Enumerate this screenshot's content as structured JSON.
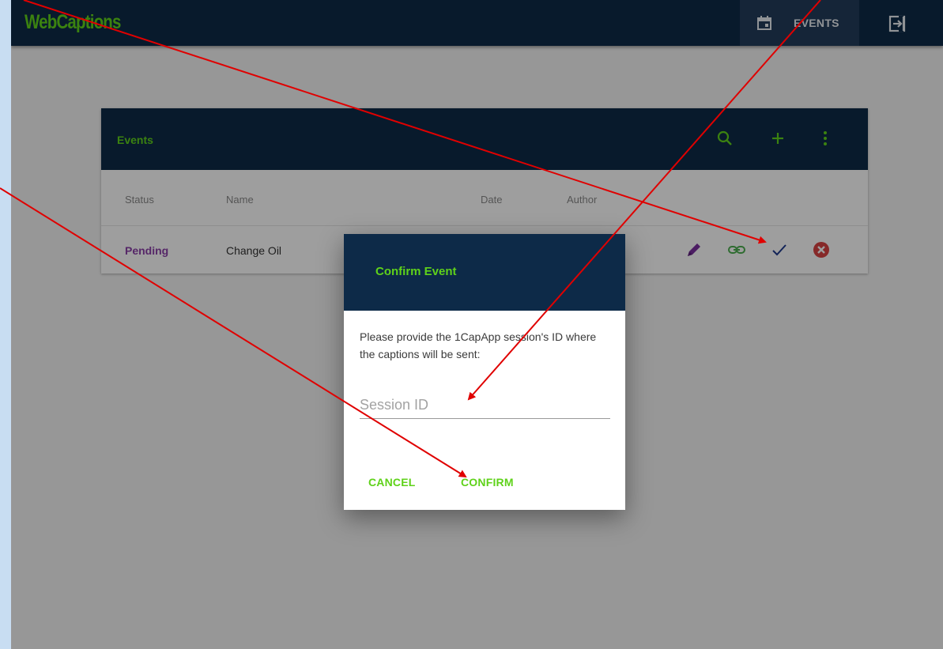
{
  "app": {
    "brand": "WebCaptions"
  },
  "nav": {
    "events_label": "EVENTS",
    "events_icon": "calendar-icon",
    "logout_icon": "logout-icon"
  },
  "events_card": {
    "title": "Events",
    "header_icons": [
      "search-icon",
      "add-icon",
      "more-vert-icon"
    ],
    "columns": [
      "Status",
      "Name",
      "Date",
      "Author"
    ],
    "rows": [
      {
        "status": "Pending",
        "name": "Change Oil",
        "date": "",
        "author": "",
        "actions": [
          "edit-icon",
          "link-icon",
          "check-icon",
          "cancel-icon"
        ]
      }
    ]
  },
  "dialog": {
    "title": "Confirm Event",
    "message": "Please provide the 1CapApp session's ID where the captions will be sent:",
    "session_input": {
      "placeholder": "Session ID",
      "value": ""
    },
    "cancel_label": "CANCEL",
    "confirm_label": "CONFIRM"
  },
  "colors": {
    "brand_green": "#5fd21a",
    "navy": "#0d2a48",
    "pending_purple": "#8b3fa8",
    "edit_purple": "#7b2fa0",
    "link_green": "#4caf50",
    "check_navy": "#1f3a8f",
    "cancel_red": "#d84343",
    "annotation_red": "#e00000",
    "outer_background": "#c8ddf2"
  }
}
